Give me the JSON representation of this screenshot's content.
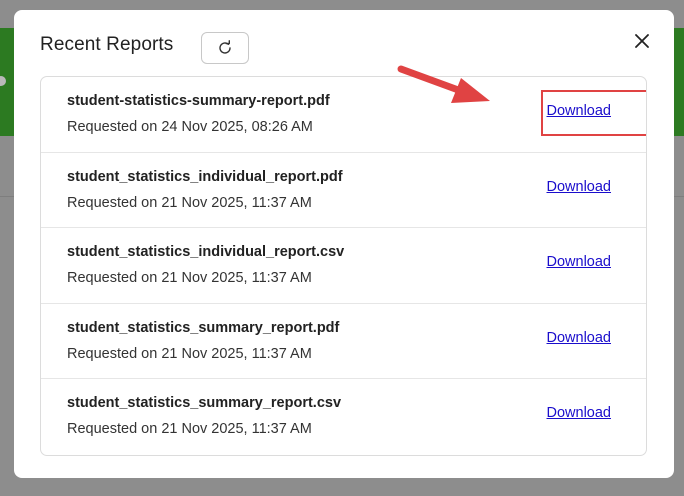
{
  "modal": {
    "title": "Recent Reports",
    "refresh_icon": "refresh-icon",
    "close_icon": "close-icon"
  },
  "reports": [
    {
      "name": "student-statistics-summary-report.pdf",
      "requested": "Requested on 24 Nov 2025, 08:26 AM",
      "action": "Download",
      "highlighted": true
    },
    {
      "name": "student_statistics_individual_report.pdf",
      "requested": "Requested on 21 Nov 2025, 11:37 AM",
      "action": "Download"
    },
    {
      "name": "student_statistics_individual_report.csv",
      "requested": "Requested on 21 Nov 2025, 11:37 AM",
      "action": "Download"
    },
    {
      "name": "student_statistics_summary_report.pdf",
      "requested": "Requested on 21 Nov 2025, 11:37 AM",
      "action": "Download"
    },
    {
      "name": "student_statistics_summary_report.csv",
      "requested": "Requested on 21 Nov 2025, 11:37 AM",
      "action": "Download"
    }
  ],
  "annotation": {
    "arrow_icon": "arrow-icon",
    "highlight_color": "#e04343"
  },
  "colors": {
    "link": "#1a0dcc",
    "backdrop": "#8d8d8d",
    "banner": "#2c7a21"
  }
}
